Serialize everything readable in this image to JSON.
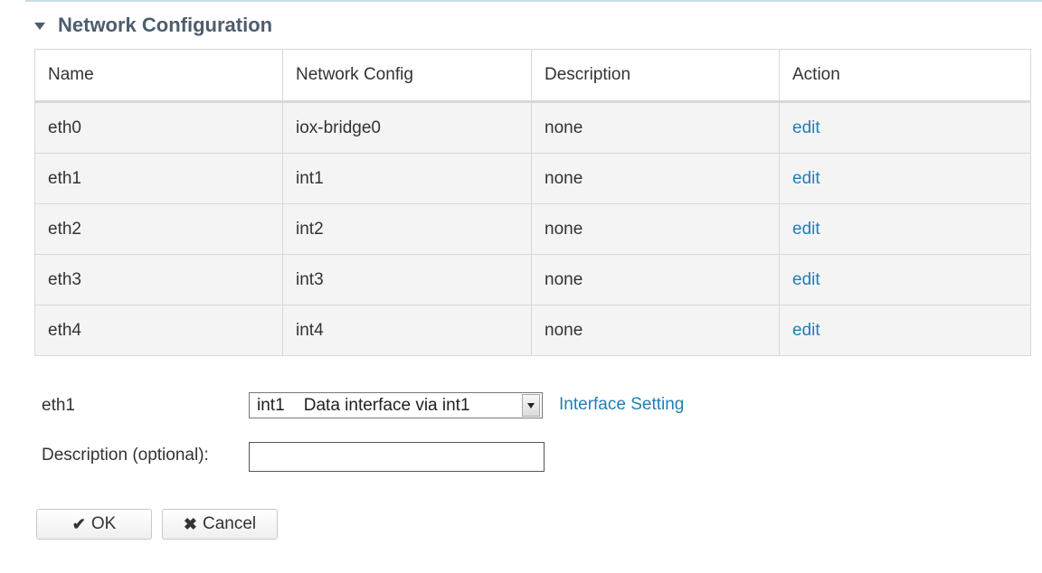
{
  "section": {
    "title": "Network Configuration"
  },
  "table": {
    "headers": [
      "Name",
      "Network Config",
      "Description",
      "Action"
    ],
    "rows": [
      {
        "name": "eth0",
        "network": "iox-bridge0",
        "description": "none",
        "action": "edit"
      },
      {
        "name": "eth1",
        "network": "int1",
        "description": "none",
        "action": "edit"
      },
      {
        "name": "eth2",
        "network": "int2",
        "description": "none",
        "action": "edit"
      },
      {
        "name": "eth3",
        "network": "int3",
        "description": "none",
        "action": "edit"
      },
      {
        "name": "eth4",
        "network": "int4",
        "description": "none",
        "action": "edit"
      }
    ]
  },
  "form": {
    "interface_label": "eth1",
    "network_select_value": "int1    Data interface via int1",
    "interface_setting_link": "Interface Setting",
    "description_label": "Description (optional):",
    "description_value": "",
    "description_placeholder": ""
  },
  "buttons": {
    "ok_icon": "✔",
    "ok_label": "OK",
    "cancel_icon": "✖",
    "cancel_label": "Cancel"
  },
  "colors": {
    "title": "#4d5d6e",
    "link": "#1f7fb4",
    "row_background": "#f4f4f4"
  },
  "icons": {
    "section_toggle": "caret-down-icon",
    "select_arrow": "chevron-down-icon",
    "ok": "checkmark-icon",
    "cancel": "x-icon"
  }
}
